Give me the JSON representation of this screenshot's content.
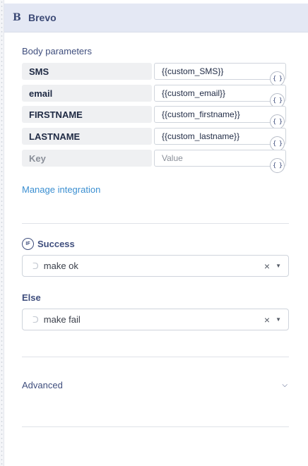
{
  "header": {
    "logo_glyph": "B",
    "title": "Brevo"
  },
  "body_parameters": {
    "label": "Body parameters",
    "rows": [
      {
        "key": "SMS",
        "value": "{{custom_SMS}}"
      },
      {
        "key": "email",
        "value": "{{custom_email}}"
      },
      {
        "key": "FIRSTNAME",
        "value": "{{custom_firstname}}"
      },
      {
        "key": "LASTNAME",
        "value": "{{custom_lastname}}"
      }
    ],
    "new_row": {
      "key_placeholder": "Key",
      "value_placeholder": "Value"
    },
    "variable_icon": "{ }"
  },
  "manage_link": "Manage integration",
  "success": {
    "icon_text": "IF",
    "label": "Success",
    "selected": "make ok"
  },
  "else": {
    "label": "Else",
    "selected": "make fail"
  },
  "advanced": {
    "label": "Advanced"
  },
  "icons": {
    "route": "route-icon",
    "clear": "×",
    "caret": "▼",
    "chevron": "⌵"
  }
}
